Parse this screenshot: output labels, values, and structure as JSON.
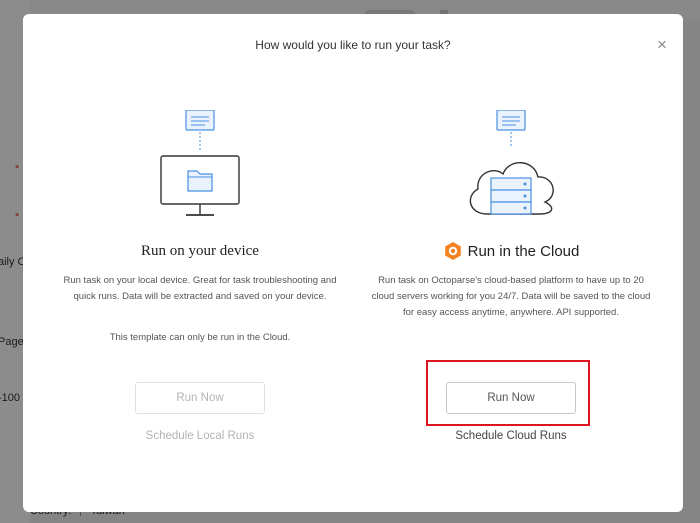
{
  "background": {
    "labels": [
      "aily C",
      "Page",
      "-100"
    ],
    "bottom_field": {
      "label": "Country:",
      "value": "Taiwan"
    }
  },
  "dialog": {
    "title": "How would you like to run your task?",
    "close_symbol": "×"
  },
  "options": {
    "local": {
      "title": "Run on your device",
      "description": "Run task on your local device. Great for task troubleshooting and quick runs. Data will be extracted and saved on your device.",
      "note": "This template can only be run in the Cloud.",
      "run_label": "Run Now",
      "schedule_label": "Schedule Local Runs",
      "enabled": false
    },
    "cloud": {
      "title": "Run in the Cloud",
      "description": "Run task on Octoparse's cloud-based platform to have up to 20 cloud servers working for you 24/7. Data will be saved to the cloud for easy access anytime, anywhere. API supported.",
      "run_label": "Run Now",
      "schedule_label": "Schedule Cloud Runs",
      "enabled": true
    }
  },
  "colors": {
    "accent_orange": "#f5821f",
    "icon_blue": "#4a90e2",
    "highlight_red": "#e0141e"
  },
  "icons": {
    "local": [
      "document-icon",
      "monitor-icon",
      "folder-icon"
    ],
    "cloud": [
      "document-icon",
      "cloud-server-icon",
      "octoparse-logo-icon"
    ]
  }
}
